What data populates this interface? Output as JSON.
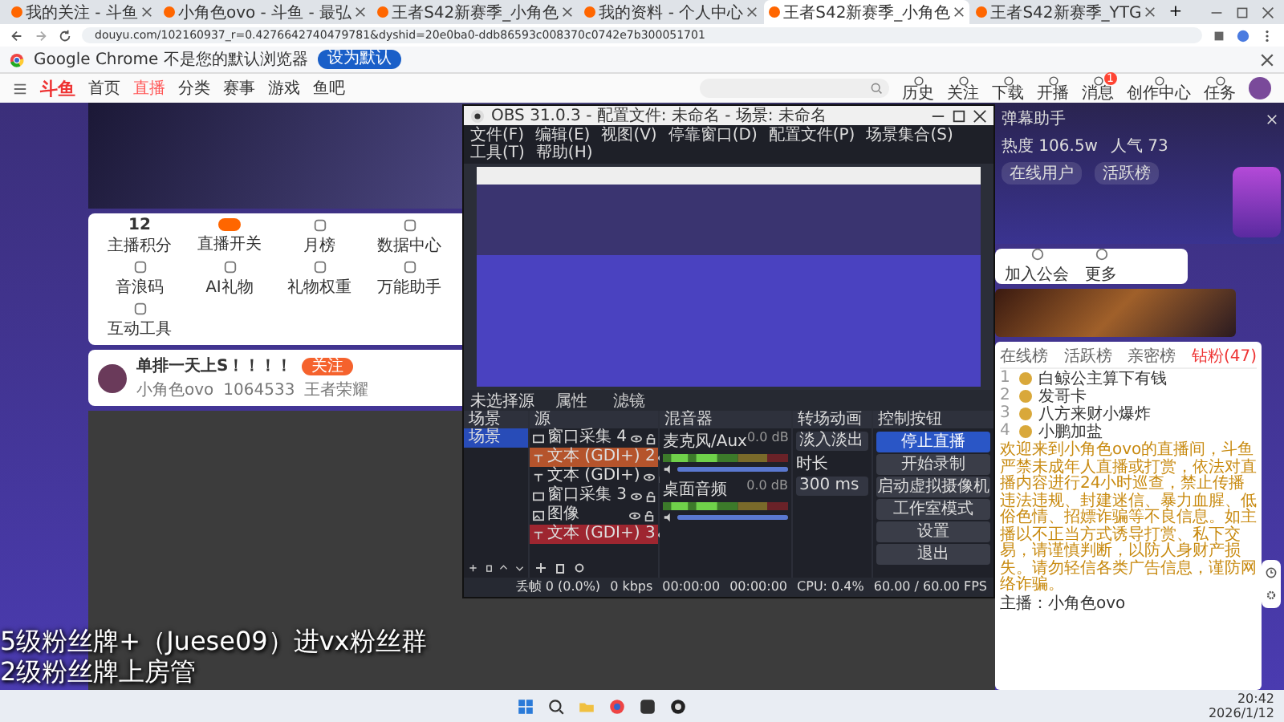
{
  "browser": {
    "tabs": [
      {
        "title": "我的关注 - 斗鱼",
        "selected": false
      },
      {
        "title": "小角色ovo - 斗鱼 - 最弘",
        "selected": false
      },
      {
        "title": "王者S42新赛季_小角色",
        "selected": false
      },
      {
        "title": "我的资料 - 个人中心",
        "selected": false
      },
      {
        "title": "王者S42新赛季_小角色",
        "selected": true
      },
      {
        "title": "王者S42新赛季_YTG",
        "selected": false
      }
    ],
    "new_tab": "+",
    "url": "douyu.com/102160937_r=0.4276642740479781&dyshid=20e0ba0-ddb86593c008370c0742e7b300051701",
    "infobar": {
      "message": "Google Chrome 不是您的默认浏览器",
      "button": "设为默认"
    }
  },
  "site_nav": {
    "logo": "斗鱼",
    "items": [
      {
        "label": "首页",
        "selected": false
      },
      {
        "label": "直播",
        "selected": true
      },
      {
        "label": "分类",
        "selected": false
      },
      {
        "label": "赛事",
        "selected": false
      },
      {
        "label": "游戏",
        "selected": false
      },
      {
        "label": "鱼吧",
        "selected": false
      }
    ],
    "actions": [
      "历史",
      "关注",
      "下载",
      "开播",
      "消息",
      "创作中心",
      "任务"
    ],
    "message_badge": "1"
  },
  "room": {
    "score": "12",
    "score_label": "主播积分",
    "tools": [
      "直播开关",
      "月榜",
      "数据中心",
      "音浪码",
      "AI礼物",
      "礼物权重",
      "万能助手",
      "互动工具"
    ],
    "tools_right": [
      "加入公会",
      "更多"
    ],
    "streamer": {
      "title": "单排一天上S！！！！",
      "follow": "关注",
      "name": "小角色ovo",
      "hot": "1064533",
      "category": "王者荣耀"
    }
  },
  "obs": {
    "title": "OBS 31.0.3 - 配置文件: 未命名 - 场景: 未命名",
    "menu": [
      "文件(F)",
      "编辑(E)",
      "视图(V)",
      "停靠窗口(D)",
      "配置文件(P)",
      "场景集合(S)",
      "工具(T)",
      "帮助(H)"
    ],
    "source_bar": {
      "label": "未选择源",
      "buttons": [
        "属性",
        "滤镜"
      ]
    },
    "scenes": {
      "title": "场景",
      "items": [
        {
          "name": "场景",
          "selected": true
        }
      ]
    },
    "sources": {
      "title": "源",
      "items": [
        {
          "kind": "window",
          "name": "窗口采集 4"
        },
        {
          "kind": "text",
          "name": "文本 (GDI+) 2",
          "color": "#b5542c"
        },
        {
          "kind": "text",
          "name": "文本 (GDI+)"
        },
        {
          "kind": "window",
          "name": "窗口采集 3"
        },
        {
          "kind": "image",
          "name": "图像"
        },
        {
          "kind": "text",
          "name": "文本 (GDI+) 3",
          "color": "#9e2630"
        }
      ]
    },
    "mixer": {
      "title": "混音器",
      "channels": [
        {
          "name": "麦克风/Aux",
          "reading": "0.0 dB",
          "level": 1
        },
        {
          "name": "桌面音频",
          "reading": "0.0 dB",
          "level": 1
        }
      ]
    },
    "transitions": {
      "title": "转场动画",
      "transition": "淡入淡出",
      "duration_label": "时长",
      "duration": "300 ms"
    },
    "controls": {
      "title": "控制按钮",
      "buttons": [
        {
          "label": "停止直播",
          "selected": true
        },
        {
          "label": "开始录制",
          "selected": false
        },
        {
          "label": "启动虚拟摄像机",
          "selected": false
        },
        {
          "label": "工作室模式",
          "selected": false
        },
        {
          "label": "设置",
          "selected": false
        },
        {
          "label": "退出",
          "selected": false
        }
      ]
    },
    "status_bar": [
      "丢帧 0 (0.0%)",
      "0 kbps",
      "00:00:00",
      "00:00:00",
      "CPU: 0.4%",
      "60.00 / 60.00 FPS"
    ]
  },
  "sidebar": {
    "assistant": {
      "title": "弹幕助手",
      "stats": [
        "热度 106.5w",
        "人气 73"
      ],
      "tabs": [
        "在线用户",
        "活跃榜"
      ]
    },
    "ranking": {
      "tabs": [
        {
          "label": "在线榜",
          "selected": false
        },
        {
          "label": "活跃榜",
          "selected": false
        },
        {
          "label": "亲密榜",
          "selected": false
        },
        {
          "label": "钻粉(47)",
          "selected": true
        }
      ],
      "rows": [
        {
          "rank": "1",
          "name": "白鲸公主算下有钱"
        },
        {
          "rank": "2",
          "name": "发哥卡"
        },
        {
          "rank": "3",
          "name": "八方来财小爆炸"
        },
        {
          "rank": "4",
          "name": "小鹏加盐"
        }
      ]
    },
    "notice": "欢迎来到小角色ovo的直播间，斗鱼严禁未成年人直播或打赏，依法对直播内容进行24小时巡查，禁止传播违法违规、封建迷信、暴力血腥、低俗色情、招嫖诈骗等不良信息。如主播以不正当方式诱导打赏、私下交易，请谨慎判断，以防人身财产损失。请勿轻信各类广告信息，谨防网络诈骗。",
    "host_line": "主播：小角色ovo"
  },
  "subtitles": [
    "5级粉丝牌+（Juese09）进vx粉丝群",
    "2级粉丝牌上房管"
  ],
  "taskbar": {
    "time": "20:42",
    "date": "2026/1/12"
  }
}
